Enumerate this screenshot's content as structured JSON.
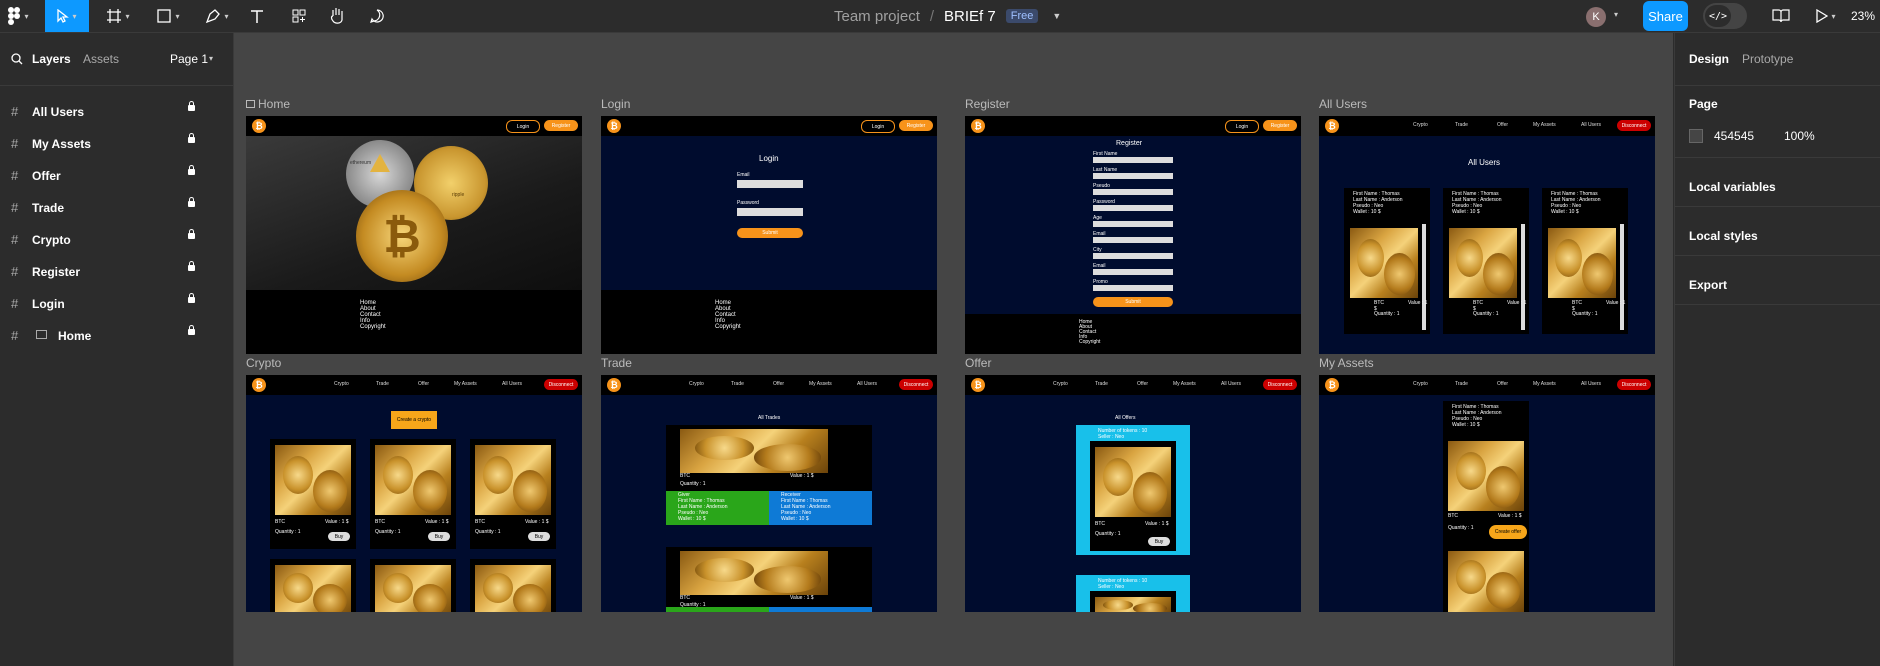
{
  "toolbar": {
    "project": "Team project",
    "separator": "/",
    "file_name": "BRIEf 7",
    "plan_badge": "Free",
    "share_label": "Share",
    "avatar_initial": "K",
    "zoom": "23%"
  },
  "left_panel": {
    "tabs": [
      "Layers",
      "Assets"
    ],
    "page_selector": "Page 1",
    "layers": [
      "All Users",
      "My Assets",
      "Offer",
      "Trade",
      "Crypto",
      "Register",
      "Login",
      "Home"
    ]
  },
  "right_panel": {
    "tabs": [
      "Design",
      "Prototype"
    ],
    "page_heading": "Page",
    "bg_color": "454545",
    "bg_opacity": "100%",
    "sections": [
      "Local variables",
      "Local styles",
      "Export"
    ]
  },
  "frames": {
    "home": "Home",
    "login": "Login",
    "register": "Register",
    "all_users": "All Users",
    "crypto": "Crypto",
    "trade": "Trade",
    "offer": "Offer",
    "my_assets": "My Assets"
  },
  "site": {
    "logo_glyph": "₿",
    "login_btn": "Login",
    "register_btn": "Register",
    "disconnect_btn": "Disconnect",
    "nav_links": [
      "Crypto",
      "Trade",
      "Offer",
      "My Assets",
      "All Users"
    ],
    "footer_links": [
      "Home",
      "About",
      "Contact",
      "Info",
      "Copyright"
    ],
    "coin_texts": [
      "ethereum",
      "ripple"
    ],
    "login_form": {
      "title": "Login",
      "email": "Email",
      "password": "Password",
      "submit": "Submit"
    },
    "register_form": {
      "title": "Register",
      "fields": [
        "First Name",
        "Last Name",
        "Pseudo",
        "Password",
        "Age",
        "Email",
        "City",
        "Email",
        "Promo"
      ],
      "submit": "Submit"
    },
    "all_users_title": "All Users",
    "user_lines": [
      "First Name : Thomas",
      "Last Name : Anderson",
      "Pseudo : Neo",
      "Wallet : 10 $"
    ],
    "asset": {
      "name": "BTC",
      "value": "Value : 1 $",
      "quantity": "Quantity : 1",
      "buy": "Buy"
    },
    "create_crypto": "Create a crypto",
    "all_trades": "All Trades",
    "giver": "Giver",
    "receiver": "Receiver",
    "all_offers": "All Offers",
    "offer_lines": [
      "Number of tokens : 10",
      "Seller : Neo"
    ],
    "create_offer": "Create offer"
  }
}
